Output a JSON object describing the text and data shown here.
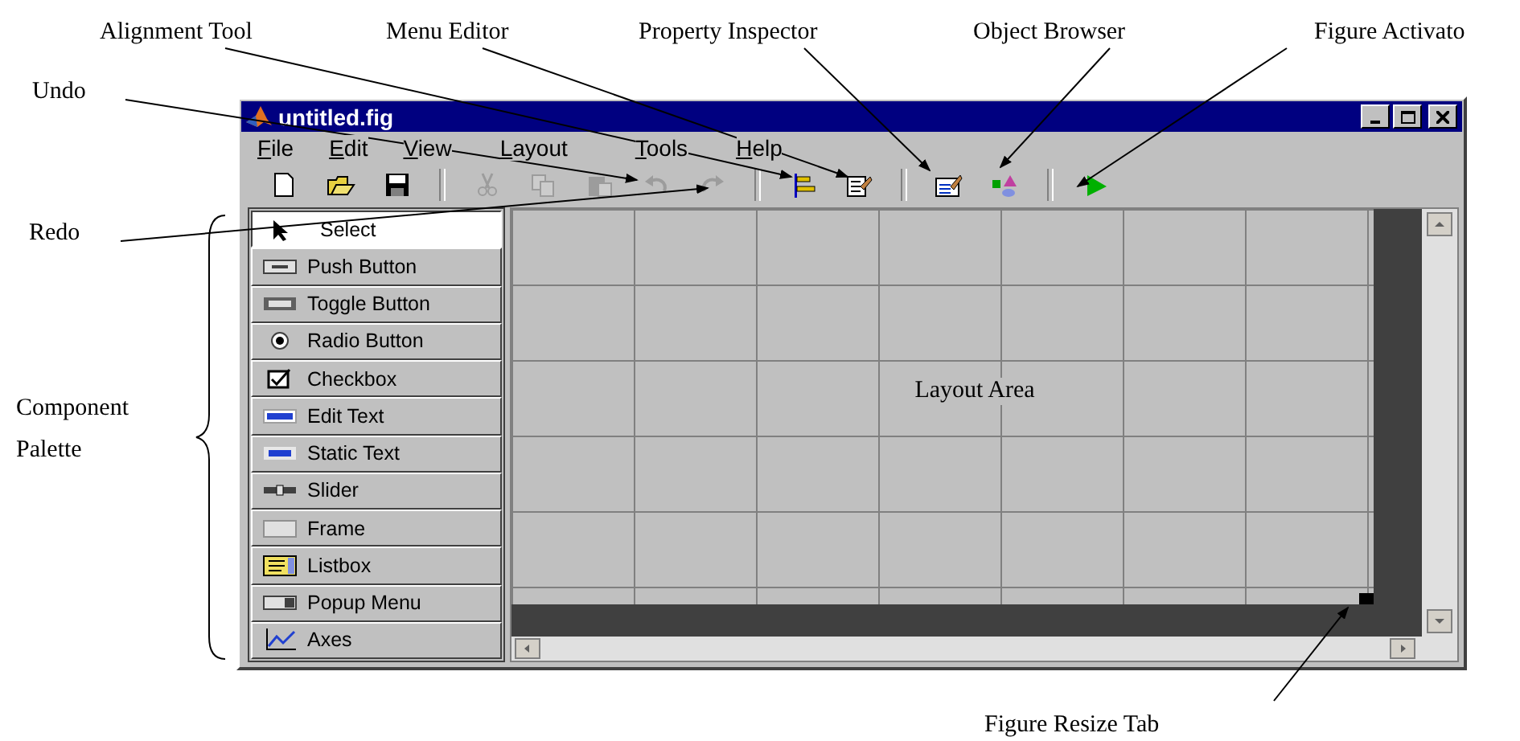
{
  "window": {
    "title": "untitled.fig"
  },
  "menu": [
    "File",
    "Edit",
    "View",
    "Layout",
    "Tools",
    "Help"
  ],
  "toolbar": [
    {
      "kind": "new",
      "disabled": false
    },
    {
      "kind": "open",
      "disabled": false
    },
    {
      "kind": "save",
      "disabled": false
    },
    {
      "kind": "separator"
    },
    {
      "kind": "cut",
      "disabled": true
    },
    {
      "kind": "copy",
      "disabled": true
    },
    {
      "kind": "paste",
      "disabled": true
    },
    {
      "kind": "undo",
      "disabled": true
    },
    {
      "kind": "redo",
      "disabled": true
    },
    {
      "kind": "separator"
    },
    {
      "kind": "align",
      "disabled": false
    },
    {
      "kind": "menueditor",
      "disabled": false
    },
    {
      "kind": "separator"
    },
    {
      "kind": "inspector",
      "disabled": false
    },
    {
      "kind": "browser",
      "disabled": false
    },
    {
      "kind": "separator"
    },
    {
      "kind": "activate",
      "disabled": false
    }
  ],
  "palette": [
    {
      "label": "Select",
      "kind": "select",
      "selected": true
    },
    {
      "label": "Push Button",
      "kind": "pushbutton",
      "selected": false
    },
    {
      "label": "Toggle Button",
      "kind": "togglebutton",
      "selected": false
    },
    {
      "label": "Radio Button",
      "kind": "radiobutton",
      "selected": false
    },
    {
      "label": "Checkbox",
      "kind": "checkbox",
      "selected": false
    },
    {
      "label": "Edit Text",
      "kind": "edit",
      "selected": false
    },
    {
      "label": "Static Text",
      "kind": "text",
      "selected": false
    },
    {
      "label": "Slider",
      "kind": "slider",
      "selected": false
    },
    {
      "label": "Frame",
      "kind": "frame",
      "selected": false
    },
    {
      "label": "Listbox",
      "kind": "listbox",
      "selected": false
    },
    {
      "label": "Popup Menu",
      "kind": "popupmenu",
      "selected": false
    },
    {
      "label": "Axes",
      "kind": "axes",
      "selected": false
    }
  ],
  "layout_area": {
    "label": "Layout Area"
  },
  "annotations": [
    "Alignment Tool",
    "Menu Editor",
    "Property Inspector",
    "Object Browser",
    "Figure Activato",
    "Undo",
    "Redo",
    "Component",
    "Palette",
    "Figure Resize Tab"
  ]
}
